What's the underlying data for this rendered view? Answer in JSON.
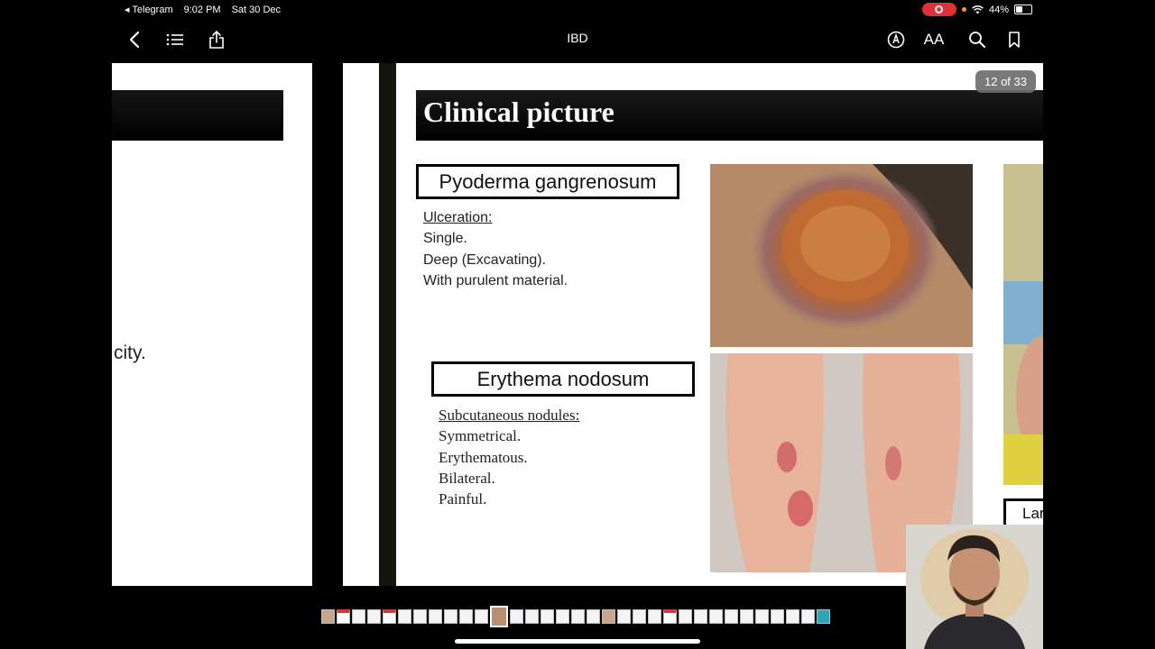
{
  "status_bar": {
    "back_app": "◂ Telegram",
    "time": "9:02 PM",
    "date": "Sat 30 Dec",
    "battery": "44%"
  },
  "nav": {
    "title": "IBD",
    "icons": [
      "chevron-left-icon",
      "list-icon",
      "share-icon",
      "markup-icon",
      "text-size-icon",
      "search-icon",
      "bookmark-icon"
    ],
    "text_size_label": "AA"
  },
  "previous_page": {
    "visible_text": "city."
  },
  "slide": {
    "page_indicator": "12 of 33",
    "title": "Clinical picture",
    "pyoderma": {
      "heading": "Pyoderma gangrenosum",
      "subheading": "Ulceration:",
      "items": [
        "Single.",
        "Deep (Excavating).",
        "With purulent material."
      ]
    },
    "erythema": {
      "heading": "Erythema nodosum",
      "subheading": "Subcutaneous nodules:",
      "items": [
        "Symmetrical.",
        "Erythematous.",
        "Bilateral.",
        "Painful."
      ]
    },
    "next_partial_label": "Lar"
  },
  "colors": {
    "header_bg": "#000000",
    "record_pill": "#e0303a",
    "slide_bg": "#ffffff"
  }
}
